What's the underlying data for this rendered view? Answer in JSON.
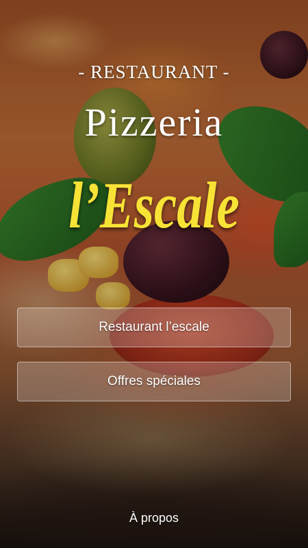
{
  "header": {
    "subtitle": "- RESTAURANT -",
    "title_main": "Pizzeria",
    "title_accent": "l’Escale"
  },
  "menu": {
    "items": [
      {
        "label": "Restaurant l’escale"
      },
      {
        "label": "Offres spéciales"
      }
    ]
  },
  "footer": {
    "about_label": "À propos"
  },
  "colors": {
    "accent_title": "#f7e236",
    "text": "#ffffff",
    "button_fill": "rgba(255,255,255,0.22)"
  },
  "background": {
    "image": "pizza-photo"
  }
}
